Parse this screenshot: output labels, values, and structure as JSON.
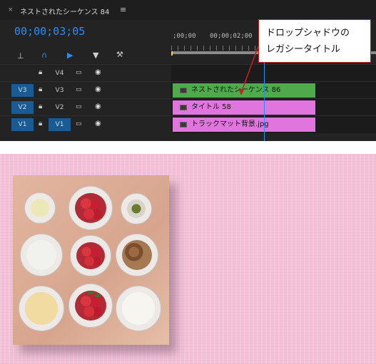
{
  "tab": {
    "close": "×",
    "title": "ネストされたシーケンス 84",
    "menu": "≡"
  },
  "timecode": "00;00;03;05",
  "ruler": {
    "labels": [
      ";00;00",
      "00;00;02;00"
    ]
  },
  "callout": {
    "line1": "ドロップシャドウの",
    "line2": "レガシータイトル"
  },
  "tracks": [
    {
      "name": "V4",
      "source": "",
      "clip": null,
      "target_active": false
    },
    {
      "name": "V3",
      "source": "V3",
      "clip": "ネストされたシーケンス 86",
      "target_active": false,
      "clip_color": "#4faa4c"
    },
    {
      "name": "V2",
      "source": "V2",
      "clip": "タイトル 58",
      "target_active": false,
      "clip_color": "#e075dd"
    },
    {
      "name": "V1",
      "source": "V1",
      "clip": "トラックマット背景.jpg",
      "target_active": true,
      "clip_color": "#e075dd"
    }
  ],
  "track_icons": {
    "lock": "lock-icon",
    "sync": "film-icon",
    "eye": "eye-icon"
  },
  "colors": {
    "accent": "#2d8ceb",
    "panel": "#232323",
    "pink_bg": "#f2c1d8",
    "callout_border": "#c52222"
  }
}
